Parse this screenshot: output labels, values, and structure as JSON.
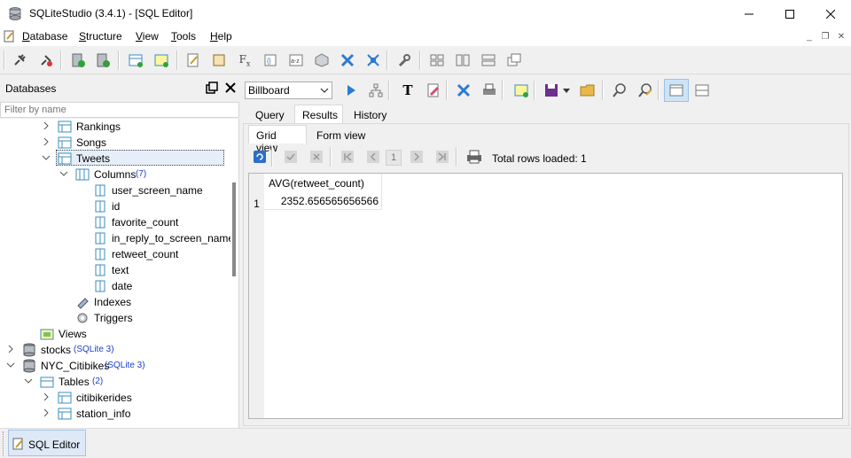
{
  "window": {
    "title": "SQLiteStudio (3.4.1) - [SQL Editor]",
    "minimize": "—",
    "maximize": "☐",
    "close": "✕"
  },
  "menu": {
    "items": [
      {
        "label": "Database",
        "underline": "D"
      },
      {
        "label": "Structure",
        "underline": "S"
      },
      {
        "label": "View",
        "underline": "V"
      },
      {
        "label": "Tools",
        "underline": "T"
      },
      {
        "label": "Help",
        "underline": "H"
      }
    ],
    "mdi_min": "_",
    "mdi_restore": "❐",
    "mdi_close": "✕"
  },
  "databases_panel": {
    "title": "Databases",
    "filter_placeholder": "Filter by name",
    "tree": {
      "rankings": "Rankings",
      "songs": "Songs",
      "tweets": "Tweets",
      "columns": "Columns",
      "columns_count": "(7)",
      "cols": [
        "user_screen_name",
        "id",
        "favorite_count",
        "in_reply_to_screen_name",
        "retweet_count",
        "text",
        "date"
      ],
      "indexes": "Indexes",
      "triggers": "Triggers",
      "views": "Views",
      "stocks": "stocks",
      "stocks_badge": "(SQLite 3)",
      "nyc": "NYC_Citibikes",
      "nyc_badge": "(SQLite 3)",
      "tables": "Tables",
      "tables_count": "(2)",
      "citibikerides": "citibikerides",
      "station_info": "station_info"
    }
  },
  "editor": {
    "db_combo": "Billboard",
    "tabs": [
      "Query",
      "Results",
      "History"
    ],
    "active_tab": "Results",
    "subtabs": [
      "Grid view",
      "Form view"
    ],
    "active_subtab": "Grid view",
    "page_number": "1",
    "total_rows": "Total rows loaded: 1",
    "grid": {
      "columns": [
        "AVG(retweet_count)"
      ],
      "rows": [
        [
          "2352.656565656566"
        ]
      ],
      "row_numbers": [
        "1"
      ]
    }
  },
  "statusbar": {
    "task": "SQL Editor"
  },
  "colors": {
    "badge": "#1a3fc8",
    "selection": "#e6eef9",
    "task_button": "#dde9f7"
  }
}
